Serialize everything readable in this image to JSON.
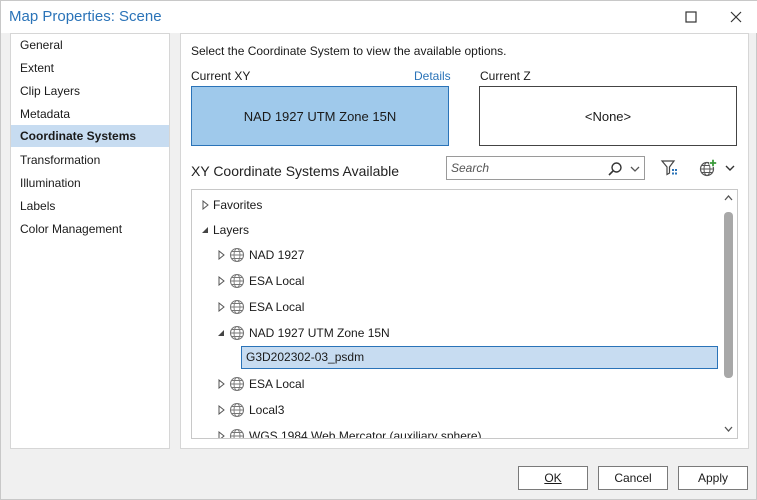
{
  "window": {
    "title": "Map Properties: Scene"
  },
  "sidebar": {
    "items": [
      {
        "label": "General",
        "selected": false
      },
      {
        "label": "Extent",
        "selected": false
      },
      {
        "label": "Clip Layers",
        "selected": false
      },
      {
        "label": "Metadata",
        "selected": false
      },
      {
        "label": "Coordinate Systems",
        "selected": true
      },
      {
        "label": "Transformation",
        "selected": false
      },
      {
        "label": "Illumination",
        "selected": false
      },
      {
        "label": "Labels",
        "selected": false
      },
      {
        "label": "Color Management",
        "selected": false
      }
    ]
  },
  "main": {
    "hint": "Select the Coordinate System to view the available options.",
    "current_xy_label": "Current XY",
    "details_link": "Details",
    "current_z_label": "Current Z",
    "current_xy_value": "NAD 1927 UTM Zone 15N",
    "current_z_value": "<None>",
    "section_title": "XY Coordinate Systems Available",
    "search_placeholder": "Search"
  },
  "tree": {
    "favorites": "Favorites",
    "layers": "Layers",
    "n1": "NAD 1927",
    "n2": "ESA Local",
    "n3": "ESA Local",
    "n4": "NAD 1927 UTM Zone 15N",
    "n4_child": "G3D202302-03_psdm",
    "n5": "ESA Local",
    "n6": "Local3",
    "n7": "WGS 1984 Web Mercator (auxiliary sphere)"
  },
  "footer": {
    "ok": "OK",
    "cancel": "Cancel",
    "apply": "Apply"
  },
  "colors": {
    "accent": "#2a73b8",
    "selection": "#c7dcf1",
    "current_xy_fill": "#9fc9eb"
  },
  "icons": [
    "maximize-icon",
    "close-icon",
    "search-icon",
    "chevron-down-icon",
    "filter-icon",
    "globe-add-icon",
    "globe-icon",
    "caret-right-icon",
    "caret-down-icon"
  ]
}
